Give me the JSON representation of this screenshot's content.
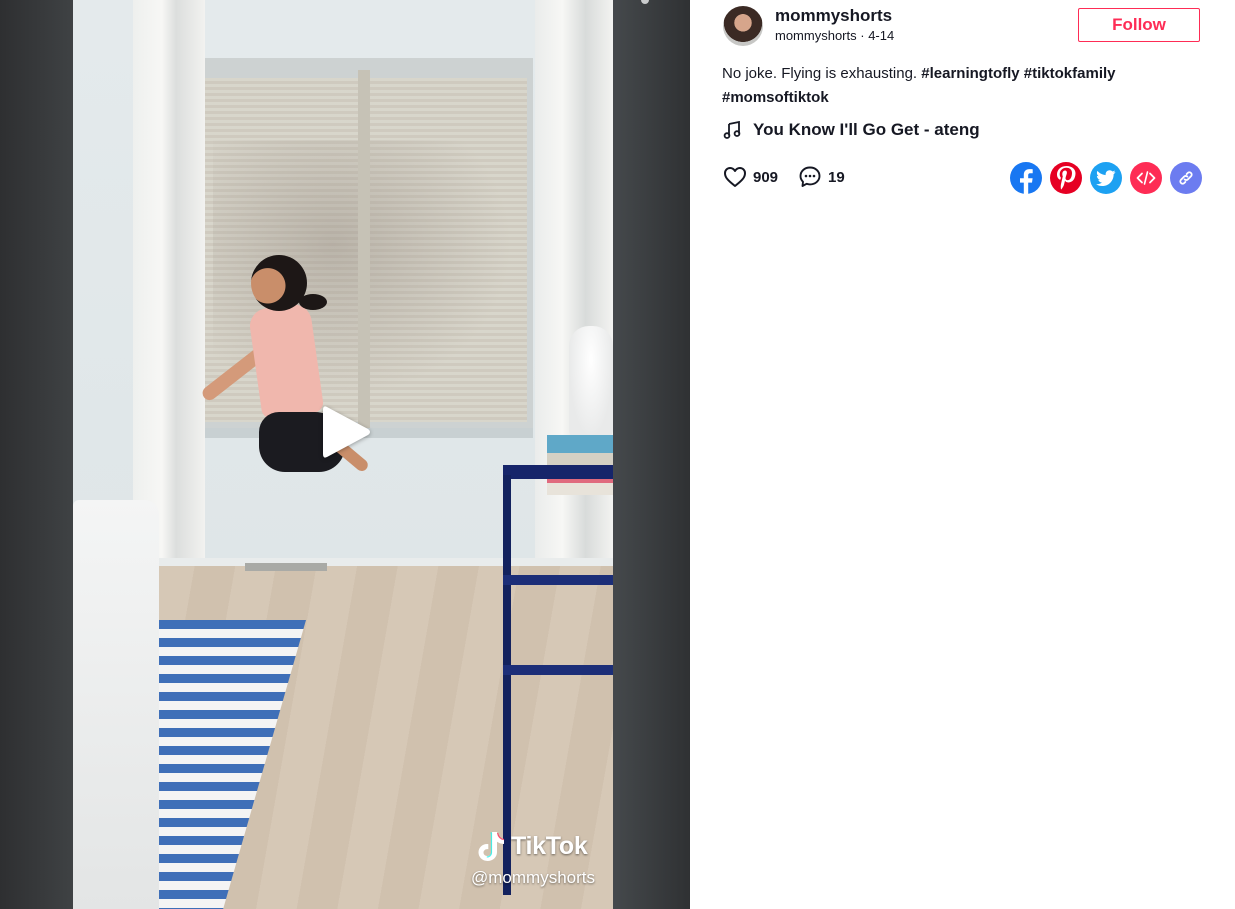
{
  "video": {
    "watermark_brand": "TikTok",
    "watermark_handle": "@mommyshorts"
  },
  "author": {
    "display_name": "mommyshorts",
    "username": "mommyshorts",
    "date": "4-14",
    "separator": " · "
  },
  "follow_label": "Follow",
  "caption": {
    "text": "No joke. Flying is exhausting. ",
    "hashtags": [
      "#learningtofly",
      "#tiktokfamily",
      "#momsoftiktok"
    ]
  },
  "music": {
    "title": "You Know I'll Go Get - ateng",
    "icon": "music-note-icon"
  },
  "stats": {
    "likes": "909",
    "comments": "19"
  },
  "share": [
    {
      "name": "facebook",
      "color": "#1877f2"
    },
    {
      "name": "pinterest",
      "color": "#e60023"
    },
    {
      "name": "twitter",
      "color": "#1da1f2"
    },
    {
      "name": "embed",
      "color": "#fe2c55"
    },
    {
      "name": "copy-link",
      "color": "#6c7cf0"
    }
  ],
  "colors": {
    "accent": "#fe2c55",
    "text": "#161823"
  }
}
